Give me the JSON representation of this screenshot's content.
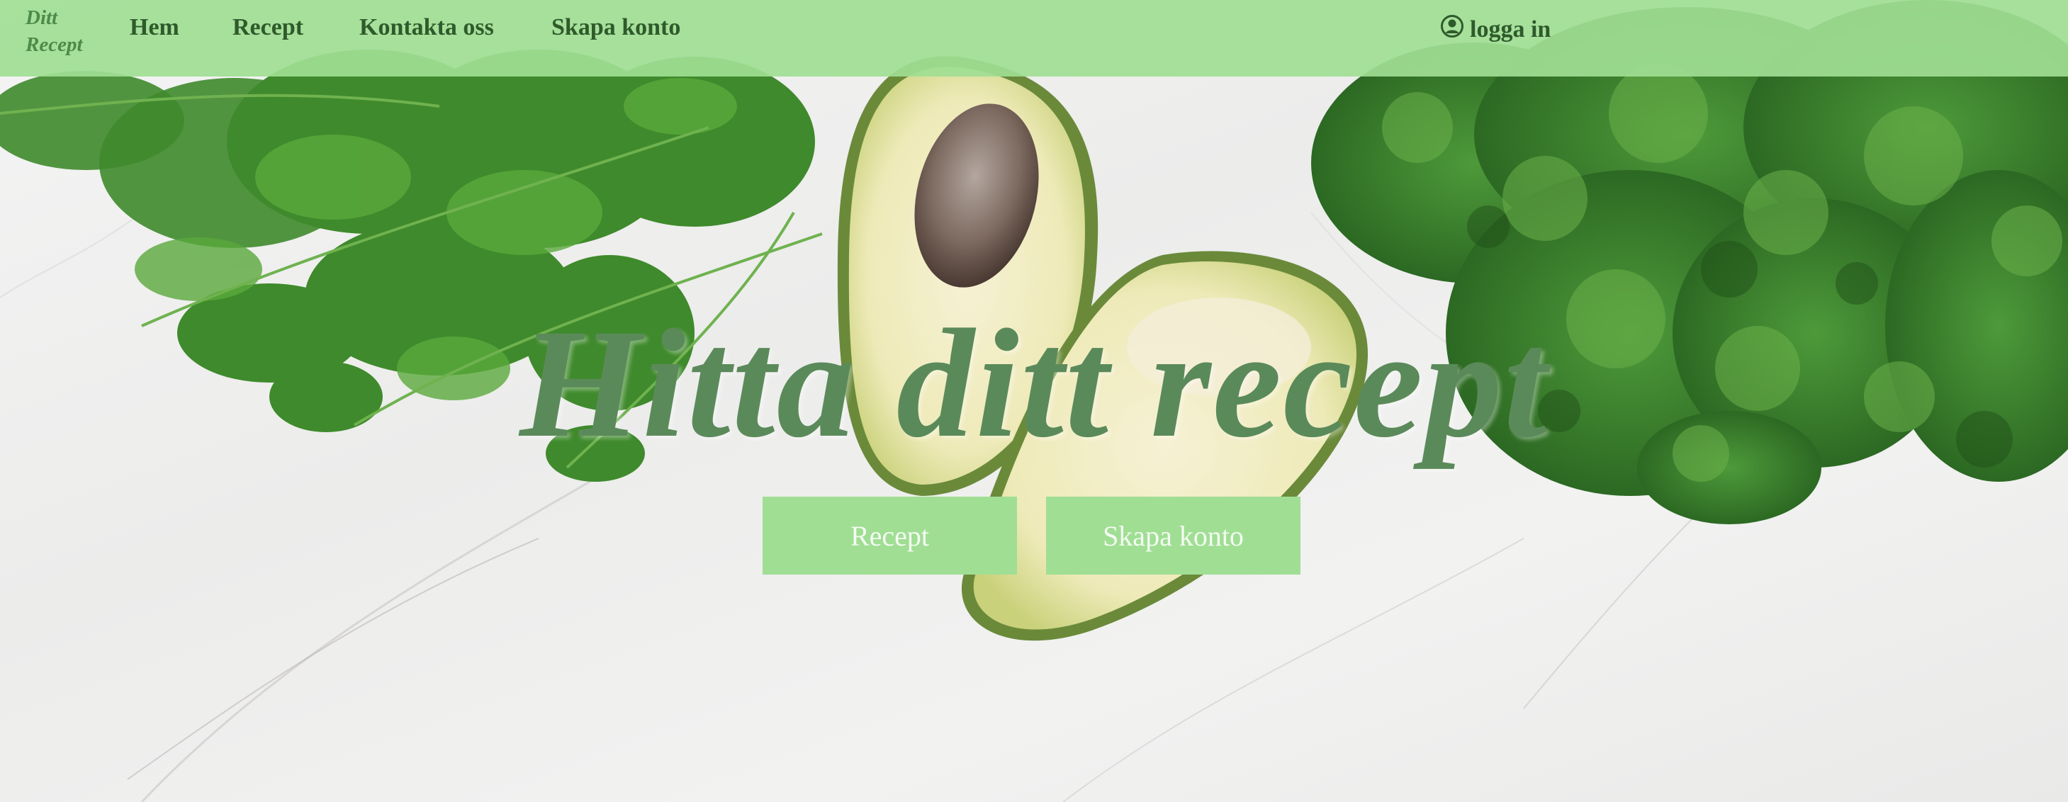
{
  "navbar": {
    "logo_line1": "Ditt",
    "logo_line2": "Recept",
    "links": [
      {
        "label": "Hem"
      },
      {
        "label": "Recept"
      },
      {
        "label": "Kontakta oss"
      },
      {
        "label": "Skapa konto"
      }
    ],
    "login_label": "logga in",
    "login_icon": "user-circle-icon"
  },
  "hero": {
    "title": "Hitta ditt recept",
    "buttons": [
      {
        "label": "Recept"
      },
      {
        "label": "Skapa konto"
      }
    ]
  },
  "colors": {
    "navbar_bg": "#a0de94",
    "nav_text": "#2f5a2b",
    "title_text": "#5b8a5a",
    "button_bg": "#a0de94",
    "button_text": "#f4fbf2"
  }
}
